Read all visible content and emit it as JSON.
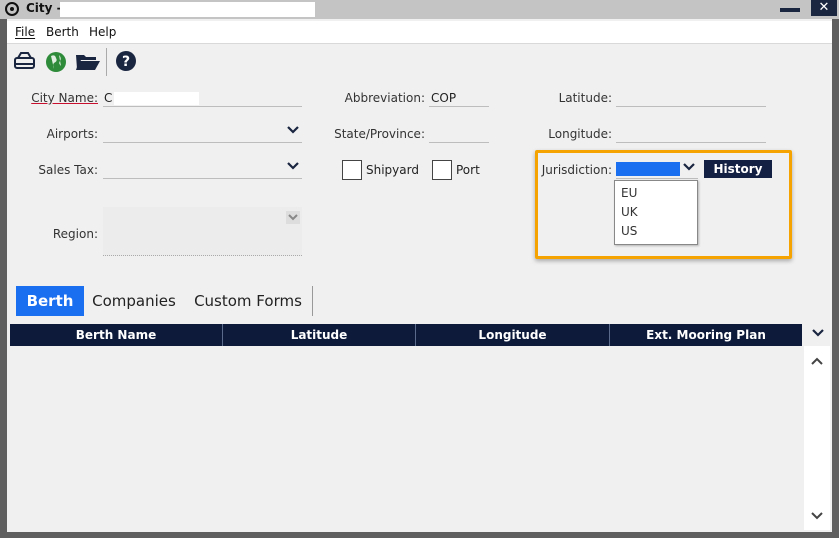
{
  "window": {
    "title": "City -"
  },
  "menu": {
    "file": "File",
    "berth": "Berth",
    "help": "Help"
  },
  "form": {
    "city_name_label": "City Name:",
    "city_name_value": "C",
    "airports_label": "Airports:",
    "sales_tax_label": "Sales Tax:",
    "region_label": "Region:",
    "abbreviation_label": "Abbreviation:",
    "abbreviation_value": "COP",
    "state_label": "State/Province:",
    "shipyard_label": "Shipyard",
    "port_label": "Port",
    "latitude_label": "Latitude:",
    "longitude_label": "Longitude:",
    "jurisdiction_label": "Jurisdiction:",
    "history_button": "History",
    "jurisdiction_options": [
      "EU",
      "UK",
      "US"
    ]
  },
  "tabs": [
    {
      "label": "Berth"
    },
    {
      "label": "Companies"
    },
    {
      "label": "Custom Forms"
    }
  ],
  "table": {
    "columns": [
      "Berth Name",
      "Latitude",
      "Longitude",
      "Ext. Mooring Plan"
    ]
  },
  "icons": {
    "save": "drive-icon",
    "globe": "globe-icon",
    "open": "folder-icon",
    "help": "help-icon"
  },
  "colors": {
    "accent": "#1a6ef0",
    "header": "#0d1a3a",
    "highlight": "#f5a300"
  }
}
